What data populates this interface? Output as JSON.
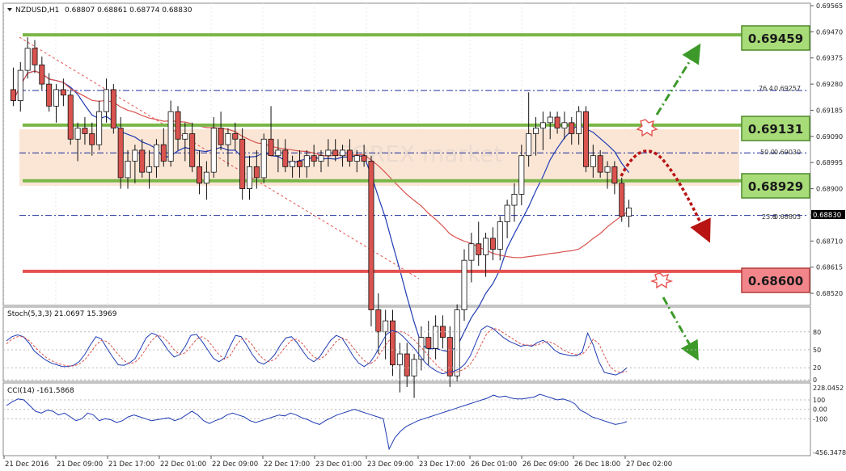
{
  "header": {
    "symbol": "NZDUSD,H1",
    "ohlc": "0.68807 0.68861 0.68774 0.68830"
  },
  "watermark": "FOREX market",
  "colors": {
    "green_level": "#7ab648",
    "green_label_fill": "#a8dc78",
    "red_level": "#e4524f",
    "red_label_fill": "#f2858a",
    "zone_fill": "#fbe6d6",
    "bull_candle": "#ffffff",
    "bear_candle": "#d9534f",
    "ma_blue": "#1f3bb3",
    "ma_red": "#d9534f",
    "forecast_green": "#3d9a2a",
    "forecast_red": "#b81414",
    "cci_line": "#1f3bb3",
    "stoch_signal": "#d9534f"
  },
  "chart_data": {
    "type": "candlestick",
    "price_axis": {
      "labels": [
        "0.69565",
        "0.69470",
        "0.69375",
        "0.69280",
        "0.69185",
        "0.69090",
        "0.68995",
        "0.68900",
        "0.68805",
        "0.68710",
        "0.68615",
        "0.68520"
      ],
      "ylim": [
        0.68485,
        0.69565
      ],
      "current_price": "0.68830"
    },
    "time_axis": {
      "labels": [
        "21 Dec 2016",
        "21 Dec 09:00",
        "21 Dec 17:00",
        "22 Dec 01:00",
        "22 Dec 09:00",
        "22 Dec 17:00",
        "23 Dec 01:00",
        "23 Dec 09:00",
        "23 Dec 17:00",
        "26 Dec 01:00",
        "26 Dec 09:00",
        "26 Dec 18:00",
        "27 Dec 02:00"
      ]
    },
    "levels": [
      {
        "label": "0.69459",
        "price": 0.69459,
        "kind": "resistance"
      },
      {
        "label": "0.69131",
        "price": 0.69131,
        "kind": "resistance"
      },
      {
        "label": "0.68929",
        "price": 0.68929,
        "kind": "support"
      },
      {
        "label": "0.68600",
        "price": 0.686,
        "kind": "support"
      }
    ],
    "fibonacci": [
      {
        "pct": "76.4",
        "price": "0.69257"
      },
      {
        "pct": "50.0",
        "price": "0.69030"
      },
      {
        "pct": "23.6",
        "price": "0.68803"
      }
    ],
    "candles": [
      [
        0.6926,
        0.6934,
        0.692,
        0.6922
      ],
      [
        0.6922,
        0.6936,
        0.6918,
        0.6933
      ],
      [
        0.6933,
        0.6945,
        0.693,
        0.6941
      ],
      [
        0.6941,
        0.6944,
        0.6932,
        0.6935
      ],
      [
        0.6935,
        0.6938,
        0.6926,
        0.6928
      ],
      [
        0.6928,
        0.6932,
        0.6918,
        0.692
      ],
      [
        0.692,
        0.6928,
        0.6914,
        0.6926
      ],
      [
        0.6926,
        0.693,
        0.692,
        0.6924
      ],
      [
        0.6924,
        0.6926,
        0.6906,
        0.6908
      ],
      [
        0.6908,
        0.6914,
        0.69,
        0.6912
      ],
      [
        0.6912,
        0.6916,
        0.6906,
        0.691
      ],
      [
        0.691,
        0.6914,
        0.6902,
        0.6906
      ],
      [
        0.6906,
        0.6922,
        0.6904,
        0.6918
      ],
      [
        0.6918,
        0.693,
        0.6914,
        0.6926
      ],
      [
        0.6926,
        0.6928,
        0.691,
        0.6912
      ],
      [
        0.6912,
        0.6916,
        0.689,
        0.6894
      ],
      [
        0.6894,
        0.6904,
        0.689,
        0.69
      ],
      [
        0.69,
        0.6906,
        0.6892,
        0.6904
      ],
      [
        0.6904,
        0.6908,
        0.6894,
        0.6896
      ],
      [
        0.6896,
        0.6904,
        0.689,
        0.6898
      ],
      [
        0.6898,
        0.6908,
        0.6894,
        0.6906
      ],
      [
        0.6906,
        0.6912,
        0.6898,
        0.69
      ],
      [
        0.69,
        0.6922,
        0.6898,
        0.6918
      ],
      [
        0.6918,
        0.692,
        0.6904,
        0.6908
      ],
      [
        0.6908,
        0.6914,
        0.69,
        0.691
      ],
      [
        0.691,
        0.6914,
        0.6896,
        0.6898
      ],
      [
        0.6898,
        0.6904,
        0.6888,
        0.6892
      ],
      [
        0.6892,
        0.69,
        0.6886,
        0.6896
      ],
      [
        0.6896,
        0.6916,
        0.6894,
        0.6912
      ],
      [
        0.6912,
        0.6918,
        0.6904,
        0.6906
      ],
      [
        0.6906,
        0.6912,
        0.6898,
        0.691
      ],
      [
        0.691,
        0.6914,
        0.6904,
        0.6908
      ],
      [
        0.6908,
        0.6912,
        0.6886,
        0.689
      ],
      [
        0.689,
        0.6902,
        0.6886,
        0.6898
      ],
      [
        0.6898,
        0.6904,
        0.689,
        0.6894
      ],
      [
        0.6894,
        0.691,
        0.6892,
        0.6908
      ],
      [
        0.6908,
        0.692,
        0.6904,
        0.6902
      ],
      [
        0.6902,
        0.6908,
        0.6896,
        0.6904
      ],
      [
        0.6904,
        0.6908,
        0.6896,
        0.6898
      ],
      [
        0.6898,
        0.6902,
        0.6894,
        0.69
      ],
      [
        0.69,
        0.6904,
        0.6894,
        0.6898
      ],
      [
        0.6898,
        0.6904,
        0.6894,
        0.6902
      ],
      [
        0.6902,
        0.6906,
        0.6898,
        0.69
      ],
      [
        0.69,
        0.6904,
        0.6896,
        0.6902
      ],
      [
        0.6902,
        0.6908,
        0.6898,
        0.6904
      ],
      [
        0.6904,
        0.6908,
        0.69,
        0.6902
      ],
      [
        0.6902,
        0.6906,
        0.6898,
        0.6904
      ],
      [
        0.6904,
        0.6908,
        0.6898,
        0.69
      ],
      [
        0.69,
        0.6904,
        0.6896,
        0.6902
      ],
      [
        0.6902,
        0.6906,
        0.6898,
        0.69
      ],
      [
        0.69,
        0.6902,
        0.684,
        0.6846
      ],
      [
        0.6846,
        0.6852,
        0.683,
        0.6838
      ],
      [
        0.6838,
        0.6846,
        0.6828,
        0.6842
      ],
      [
        0.6842,
        0.6846,
        0.6822,
        0.6826
      ],
      [
        0.6826,
        0.6834,
        0.6816,
        0.683
      ],
      [
        0.683,
        0.6834,
        0.6818,
        0.6822
      ],
      [
        0.6822,
        0.683,
        0.6814,
        0.6828
      ],
      [
        0.6828,
        0.684,
        0.6824,
        0.6836
      ],
      [
        0.6836,
        0.6842,
        0.6826,
        0.6832
      ],
      [
        0.6832,
        0.6844,
        0.6828,
        0.684
      ],
      [
        0.684,
        0.6844,
        0.6832,
        0.6836
      ],
      [
        0.6836,
        0.684,
        0.6818,
        0.6822
      ],
      [
        0.6822,
        0.6848,
        0.682,
        0.6846
      ],
      [
        0.6846,
        0.6868,
        0.6842,
        0.6864
      ],
      [
        0.6864,
        0.6874,
        0.6856,
        0.687
      ],
      [
        0.687,
        0.6878,
        0.6862,
        0.6866
      ],
      [
        0.6866,
        0.6874,
        0.6858,
        0.6872
      ],
      [
        0.6872,
        0.6876,
        0.6864,
        0.6868
      ],
      [
        0.6868,
        0.688,
        0.6864,
        0.6878
      ],
      [
        0.6878,
        0.6886,
        0.6872,
        0.6884
      ],
      [
        0.6884,
        0.6892,
        0.6878,
        0.6888
      ],
      [
        0.6888,
        0.6906,
        0.6884,
        0.6902
      ],
      [
        0.6902,
        0.6925,
        0.6898,
        0.691
      ],
      [
        0.691,
        0.6916,
        0.6902,
        0.6912
      ],
      [
        0.6912,
        0.6918,
        0.6904,
        0.6914
      ],
      [
        0.6914,
        0.6918,
        0.6908,
        0.6916
      ],
      [
        0.6916,
        0.6918,
        0.691,
        0.6912
      ],
      [
        0.6912,
        0.6918,
        0.6908,
        0.6914
      ],
      [
        0.6914,
        0.6916,
        0.6906,
        0.691
      ],
      [
        0.691,
        0.692,
        0.6906,
        0.6918
      ],
      [
        0.6918,
        0.692,
        0.6896,
        0.6898
      ],
      [
        0.6898,
        0.6906,
        0.6894,
        0.6902
      ],
      [
        0.6902,
        0.6904,
        0.6894,
        0.6896
      ],
      [
        0.6896,
        0.69,
        0.689,
        0.6898
      ],
      [
        0.6898,
        0.69,
        0.6888,
        0.6892
      ],
      [
        0.6892,
        0.6894,
        0.6878,
        0.688
      ],
      [
        0.688,
        0.6886,
        0.6876,
        0.6883
      ]
    ],
    "stochastic": {
      "label": "Stoch(5,3,3) 21.0697 15.3969",
      "ylim": [
        0,
        100
      ],
      "ticks": [
        "80",
        "50",
        "20",
        "0"
      ],
      "main": [
        65,
        72,
        75,
        72,
        62,
        48,
        40,
        33,
        28,
        25,
        22,
        22,
        24,
        30,
        42,
        58,
        72,
        68,
        52,
        38,
        25,
        24,
        28,
        35,
        52,
        70,
        78,
        74,
        62,
        48,
        38,
        42,
        56,
        74,
        76,
        64,
        50,
        36,
        30,
        36,
        56,
        74,
        72,
        58,
        42,
        30,
        26,
        32,
        42,
        58,
        70,
        72,
        62,
        48,
        36,
        30,
        38,
        52,
        66,
        74,
        70,
        56,
        40,
        28,
        22,
        28,
        42,
        60,
        76,
        82,
        80,
        72,
        62,
        52,
        40,
        28,
        20,
        14,
        10,
        12,
        14,
        18,
        26,
        40,
        62,
        84,
        90,
        86,
        78,
        70,
        64,
        60,
        56,
        58,
        56,
        62,
        66,
        60,
        50,
        44,
        42,
        40,
        40,
        46,
        78,
        58,
        30,
        12,
        10,
        8,
        12,
        20
      ],
      "signal": [
        60,
        68,
        72,
        72,
        66,
        56,
        46,
        38,
        32,
        28,
        25,
        23,
        23,
        26,
        33,
        45,
        58,
        66,
        64,
        54,
        42,
        32,
        27,
        29,
        38,
        52,
        66,
        74,
        72,
        62,
        50,
        42,
        45,
        56,
        68,
        72,
        66,
        54,
        42,
        34,
        40,
        56,
        68,
        68,
        58,
        44,
        34,
        30,
        34,
        44,
        56,
        66,
        68,
        60,
        48,
        38,
        34,
        40,
        52,
        64,
        70,
        66,
        54,
        42,
        32,
        26,
        32,
        46,
        60,
        72,
        80,
        80,
        74,
        66,
        56,
        46,
        34,
        24,
        16,
        12,
        12,
        14,
        18,
        26,
        40,
        60,
        78,
        86,
        84,
        78,
        72,
        66,
        60,
        58,
        58,
        58,
        62,
        64,
        60,
        54,
        48,
        44,
        42,
        42,
        52,
        68,
        60,
        40,
        22,
        14,
        12,
        14
      ]
    },
    "cci": {
      "label": "CCI(14) -161.5868",
      "ylim": [
        -456.3478,
        228.0452
      ],
      "ticks": [
        "228.0452",
        "100",
        "0.00",
        "-100",
        "-456.3478"
      ],
      "values": [
        40,
        80,
        110,
        100,
        40,
        -20,
        -40,
        -10,
        -20,
        -60,
        -40,
        -80,
        -120,
        -100,
        -40,
        -60,
        -120,
        -100,
        -110,
        -140,
        -120,
        -80,
        -60,
        -80,
        -100,
        -120,
        -110,
        -100,
        -90,
        -120,
        -100,
        -60,
        -20,
        -60,
        -120,
        -150,
        -120,
        -100,
        -60,
        -40,
        -60,
        -80,
        -120,
        -140,
        -120,
        -100,
        -80,
        -60,
        -70,
        -40,
        -60,
        -90,
        -110,
        -140,
        -160,
        -120,
        -90,
        -60,
        -40,
        -20,
        0,
        -20,
        -40,
        -60,
        -80,
        -100,
        -420,
        -300,
        -230,
        -180,
        -150,
        -120,
        -100,
        -80,
        -60,
        -40,
        -20,
        0,
        20,
        40,
        60,
        80,
        100,
        120,
        150,
        130,
        140,
        120,
        110,
        110,
        120,
        130,
        160,
        140,
        120,
        100,
        110,
        90,
        60,
        -10,
        -40,
        -80,
        -100,
        -120,
        -140,
        -160,
        -150,
        -130
      ]
    }
  }
}
